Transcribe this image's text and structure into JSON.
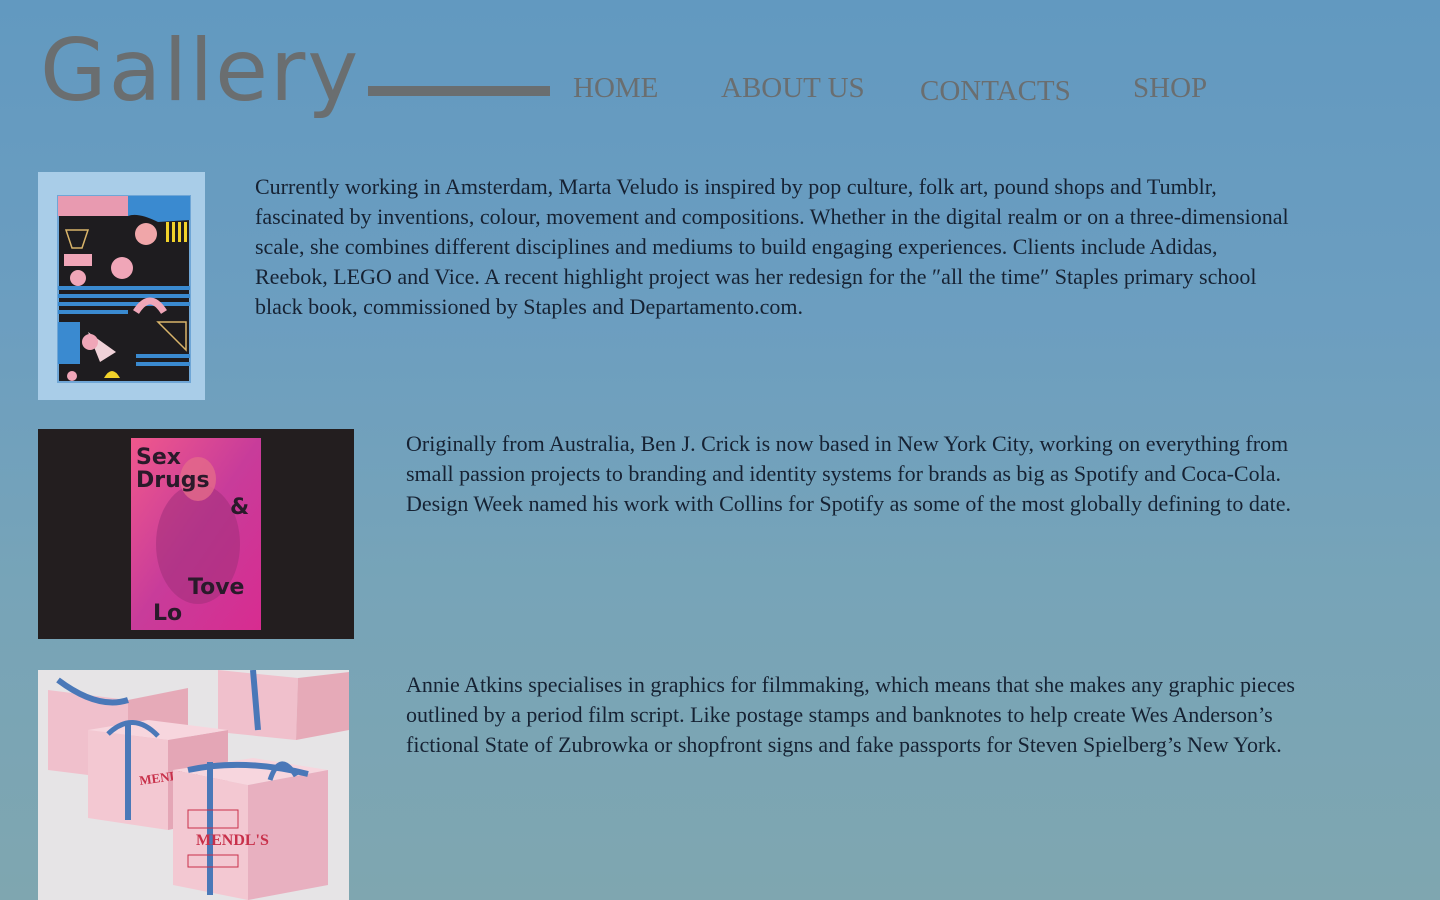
{
  "header": {
    "logo_text": "Gallery",
    "nav": {
      "home": "HOME",
      "about": "ABOUT US",
      "contacts": "CONTACTS",
      "shop": "SHOP"
    }
  },
  "entries": [
    {
      "image": "abstract-pink-black-poster",
      "text": "Currently working in Amsterdam, Marta Veludo is inspired by pop culture, folk art, pound shops and Tumblr, fascinated by inventions, colour, movement and compositions. Whether in the digital realm or on a three-dimensional scale, she combines different disciplines and mediums to build engaging experiences. Clients include Adidas, Reebok, LEGO and Vice. A recent highlight project was her redesign for the ″all the time″ Staples primary school black book, commissioned by Staples and Departamento.com."
    },
    {
      "image": "tove-lo-poster",
      "poster_text": [
        "Sex",
        "Drugs",
        "&",
        "Tove",
        "Lo"
      ],
      "text": "Originally from Australia, Ben J. Crick is now based in New York City, working on everything from small passion projects to branding and identity systems for brands as big as Spotify and Coca-Cola. Design Week named his work with Collins for Spotify as some of the most globally defining to date."
    },
    {
      "image": "mendls-pink-boxes",
      "box_label": "MENDL'S",
      "text": "Annie Atkins specialises in graphics for filmmaking, which means that she makes any graphic pieces outlined by a period film script. Like postage stamps and banknotes to help create Wes Anderson’s fictional State of Zubrowka or shopfront signs and fake passports for Steven Spielberg’s New York."
    }
  ],
  "colors": {
    "background_top": "#6299c0",
    "background_bottom": "#7fa6b0",
    "header_gray": "#6a6e70",
    "body_text": "#162233"
  }
}
